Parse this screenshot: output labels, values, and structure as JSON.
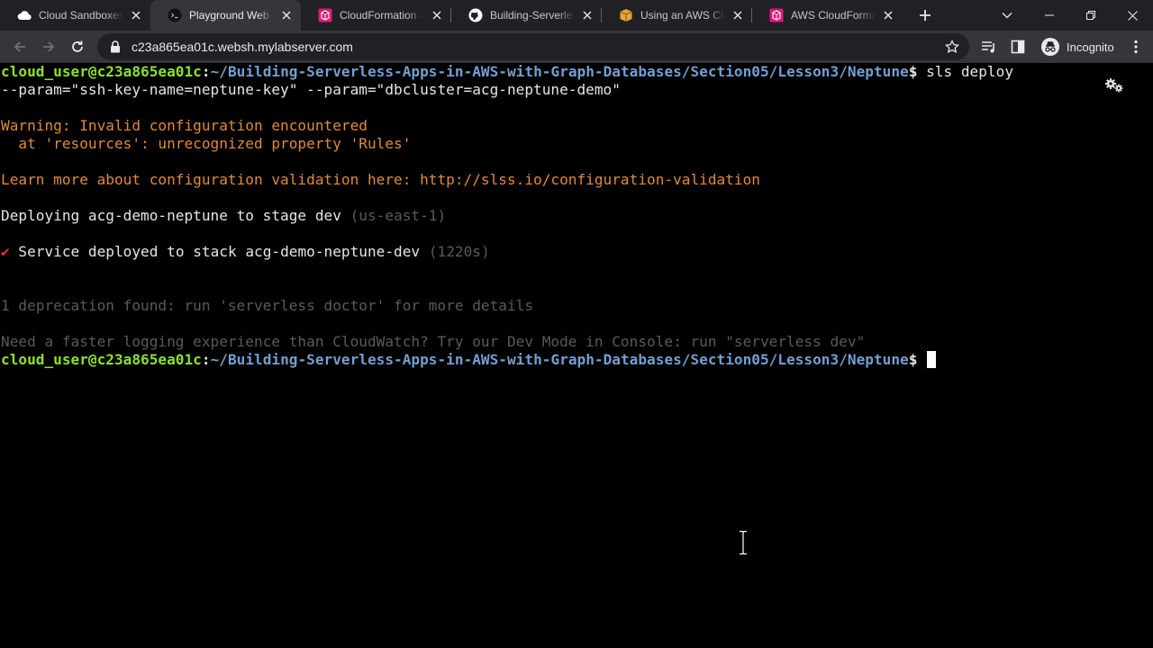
{
  "tabs": [
    {
      "title": "Cloud Sandboxes - A Cloud Guru",
      "active": false,
      "favicon": "cloud-guru-icon"
    },
    {
      "title": "Playground Web Terminal",
      "active": true,
      "favicon": "terminal-icon"
    },
    {
      "title": "CloudFormation - Stack",
      "active": false,
      "favicon": "cloudformation-icon"
    },
    {
      "title": "Building-Serverless-Apps",
      "active": false,
      "favicon": "github-icon"
    },
    {
      "title": "Using an AWS Cloud",
      "active": false,
      "favicon": "aws-box-icon"
    },
    {
      "title": "AWS CloudFormation",
      "active": false,
      "favicon": "cloudformation-icon"
    }
  ],
  "toolbar": {
    "url": "c23a865ea01c.websh.mylabserver.com",
    "profile_label": "Incognito"
  },
  "terminal": {
    "prompt_user": "cloud_user@c23a865ea01c",
    "prompt_path": "~/Building-Serverless-Apps-in-AWS-with-Graph-Databases/Section05/Lesson3/Neptune",
    "prompt_symbol": "$",
    "command_part1": "sls deploy",
    "command_part2": "--param=\"ssh-key-name=neptune-key\" --param=\"dbcluster=acg-neptune-demo\"",
    "warning_line1": "Warning: Invalid configuration encountered",
    "warning_line2": "  at 'resources': unrecognized property 'Rules'",
    "learn_more": "Learn more about configuration validation here: http://slss.io/configuration-validation",
    "deploying": "Deploying acg-demo-neptune to stage dev",
    "deploying_region": "(us-east-1)",
    "check_mark": "✔",
    "deployed": "Service deployed to stack acg-demo-neptune-dev",
    "deployed_time": "(1220s)",
    "deprecation": "1 deprecation found: run 'serverless doctor' for more details",
    "tip": "Need a faster logging experience than CloudWatch? Try our Dev Mode in Console: run \"serverless dev\""
  },
  "colors": {
    "tabstrip_bg": "#202124",
    "toolbar_bg": "#35363a",
    "prompt_user": "#8ae234",
    "prompt_path": "#729fcf",
    "warning": "#e08a3a",
    "dim": "#5a5a5a"
  }
}
